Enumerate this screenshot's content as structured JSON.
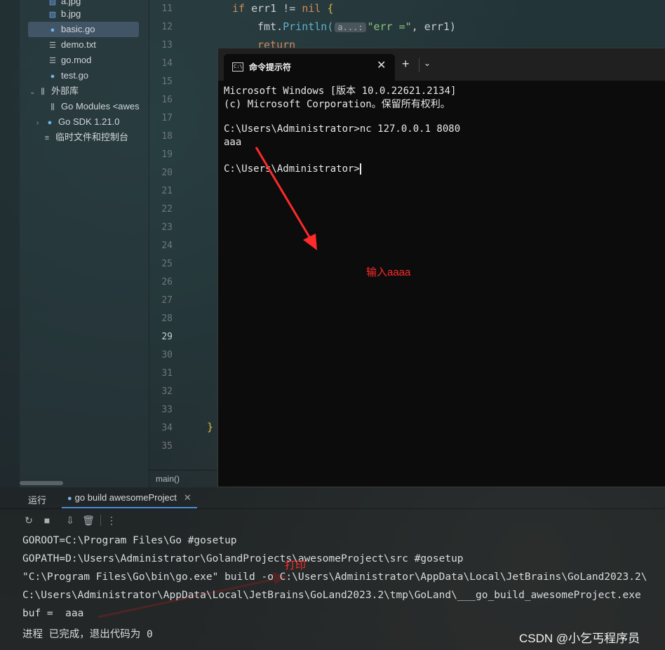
{
  "project_tree": {
    "items": [
      {
        "label": "a.jpg",
        "icon": "image-file-icon"
      },
      {
        "label": "b.jpg",
        "icon": "image-file-icon"
      },
      {
        "label": "basic.go",
        "icon": "go-file-icon"
      },
      {
        "label": "demo.txt",
        "icon": "text-file-icon"
      },
      {
        "label": "go.mod",
        "icon": "text-file-icon"
      },
      {
        "label": "test.go",
        "icon": "go-file-icon"
      },
      {
        "label": "外部库",
        "icon": "library-icon"
      },
      {
        "label": "Go Modules <awes",
        "icon": "library-icon"
      },
      {
        "label": "Go SDK 1.21.0",
        "icon": "go-sdk-icon"
      },
      {
        "label": "临时文件和控制台",
        "icon": "scratches-icon"
      }
    ]
  },
  "editor": {
    "line_numbers": [
      "11",
      "12",
      "13",
      "14",
      "15",
      "16",
      "17",
      "18",
      "19",
      "20",
      "21",
      "22",
      "23",
      "24",
      "25",
      "26",
      "27",
      "28",
      "29",
      "30",
      "31",
      "32",
      "33",
      "34",
      "35"
    ],
    "active_line": "29",
    "code": {
      "l11_kw_if": "if",
      "l11_rest": " err1 != ",
      "l11_kw_nil": "nil",
      "l11_brace": " {",
      "l12_pkg": "fmt.",
      "l12_fn": "Println(",
      "l12_hint": "a...:",
      "l12_str": "\"err =\"",
      "l12_rest": ", err1)",
      "l13_kw": "return",
      "l34_brace": "}"
    },
    "breadcrumb": "main()"
  },
  "terminal": {
    "tab_title": "命令提示符",
    "lines": [
      "Microsoft Windows [版本 10.0.22621.2134]",
      "(c) Microsoft Corporation。保留所有权利。",
      "",
      "C:\\Users\\Administrator>nc 127.0.0.1 8080",
      "aaa",
      "",
      "C:\\Users\\Administrator>"
    ]
  },
  "annotations": {
    "input_note": "输入aaaa",
    "print_note": "打印"
  },
  "run_panel": {
    "label": "运行",
    "tab_title": "go build awesomeProject",
    "output": [
      "GOROOT=C:\\Program Files\\Go #gosetup",
      "GOPATH=D:\\Users\\Administrator\\GolandProjects\\awesomeProject\\src #gosetup",
      "\"C:\\Program Files\\Go\\bin\\go.exe\" build -o C:\\Users\\Administrator\\AppData\\Local\\JetBrains\\GoLand2023.2\\",
      "C:\\Users\\Administrator\\AppData\\Local\\JetBrains\\GoLand2023.2\\tmp\\GoLand\\___go_build_awesomeProject.exe",
      "buf =  aaa",
      "进程 已完成，退出代码为 0"
    ]
  },
  "watermark": "CSDN @小乞丐程序员",
  "colors": {
    "annotation_red": "#ff2a2a",
    "terminal_bg": "#0c0c0c",
    "keyword": "#d08a5a",
    "string": "#8fc07d"
  }
}
